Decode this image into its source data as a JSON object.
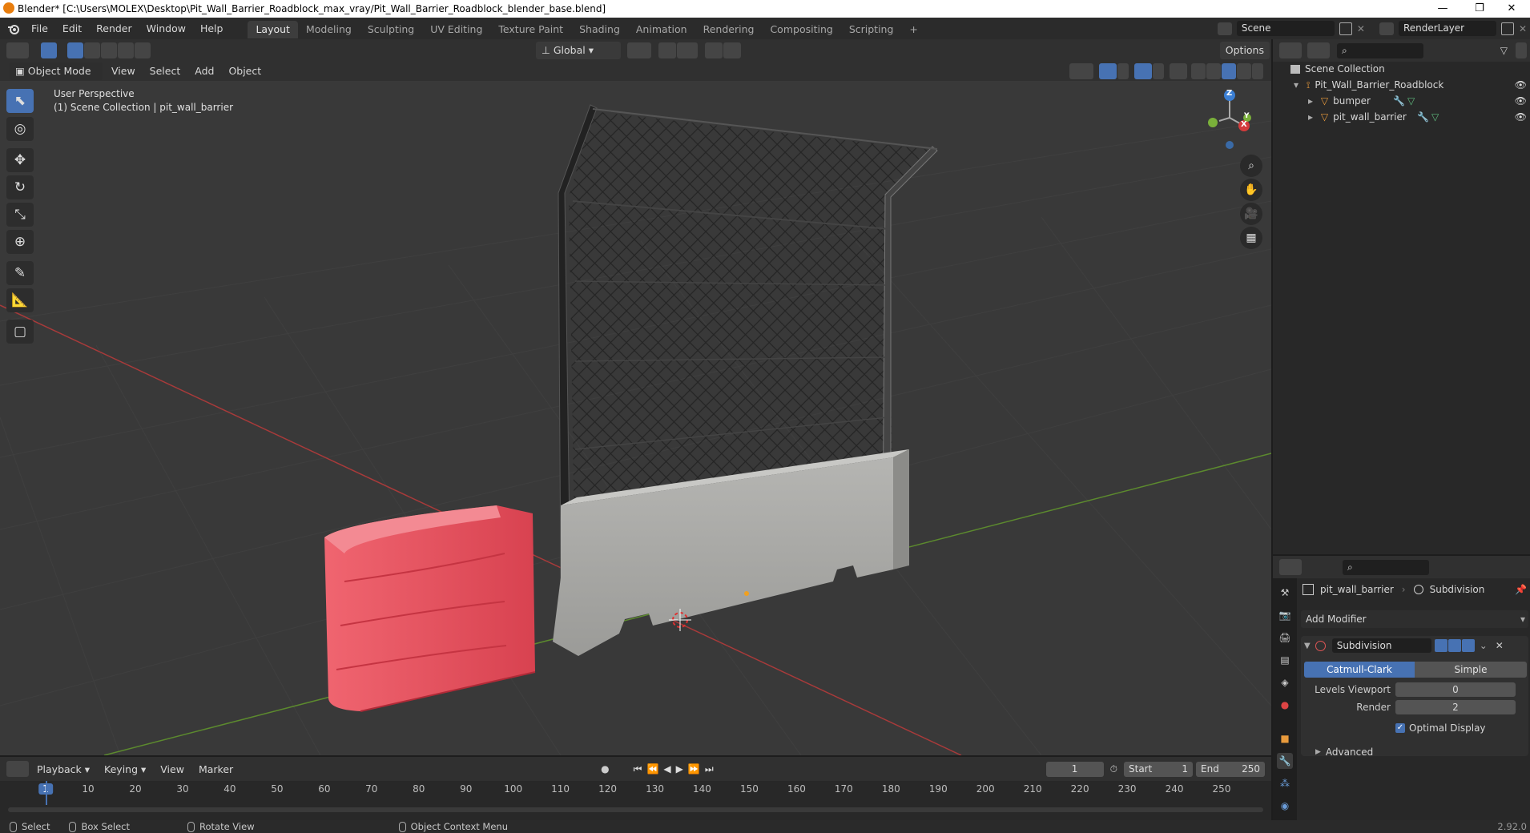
{
  "window": {
    "title": "Blender* [C:\\Users\\MOLEX\\Desktop\\Pit_Wall_Barrier_Roadblock_max_vray/Pit_Wall_Barrier_Roadblock_blender_base.blend]",
    "minimize": "—",
    "restore": "❐",
    "close": "✕"
  },
  "menu": {
    "items": [
      "File",
      "Edit",
      "Render",
      "Window",
      "Help"
    ]
  },
  "workspaces": {
    "tabs": [
      "Layout",
      "Modeling",
      "Sculpting",
      "UV Editing",
      "Texture Paint",
      "Shading",
      "Animation",
      "Rendering",
      "Compositing",
      "Scripting"
    ],
    "active": "Layout",
    "add": "+"
  },
  "scene": {
    "name": "Scene",
    "render_layer": "RenderLayer"
  },
  "viewport_header": {
    "transform_orientation": "Global",
    "options": "Options",
    "mode": "Object Mode",
    "menus": [
      "View",
      "Select",
      "Add",
      "Object"
    ]
  },
  "viewport": {
    "perspective": "User Perspective",
    "collection_info": "(1) Scene Collection | pit_wall_barrier",
    "gizmo": {
      "z": "Z",
      "x": "X",
      "y": "Y"
    }
  },
  "outliner": {
    "root": "Scene Collection",
    "collection": "Pit_Wall_Barrier_Roadblock",
    "objects": [
      "bumper",
      "pit_wall_barrier"
    ]
  },
  "properties": {
    "object_name": "pit_wall_barrier",
    "modifier_crumb": "Subdivision",
    "add_modifier": "Add Modifier",
    "modifier": {
      "name": "Subdivision",
      "type_options": [
        "Catmull-Clark",
        "Simple"
      ],
      "active_type": "Catmull-Clark",
      "levels_viewport_label": "Levels Viewport",
      "levels_viewport": "0",
      "render_label": "Render",
      "render": "2",
      "optimal_display": "Optimal Display",
      "advanced": "Advanced"
    }
  },
  "timeline": {
    "menus": [
      "Playback",
      "Keying",
      "View",
      "Marker"
    ],
    "current_frame": "1",
    "start_label": "Start",
    "start": "1",
    "end_label": "End",
    "end": "250",
    "ticks": [
      "1",
      "10",
      "20",
      "30",
      "40",
      "50",
      "60",
      "70",
      "80",
      "90",
      "100",
      "110",
      "120",
      "130",
      "140",
      "150",
      "160",
      "170",
      "180",
      "190",
      "200",
      "210",
      "220",
      "230",
      "240",
      "250"
    ]
  },
  "statusbar": {
    "select": "Select",
    "box_select": "Box Select",
    "rotate_view": "Rotate View",
    "context_menu": "Object Context Menu",
    "version": "2.92.0"
  },
  "colors": {
    "accent": "#4772b3",
    "bumper": "#e8505b",
    "concrete": "#a8a8a8",
    "viewport_bg": "#393939"
  }
}
